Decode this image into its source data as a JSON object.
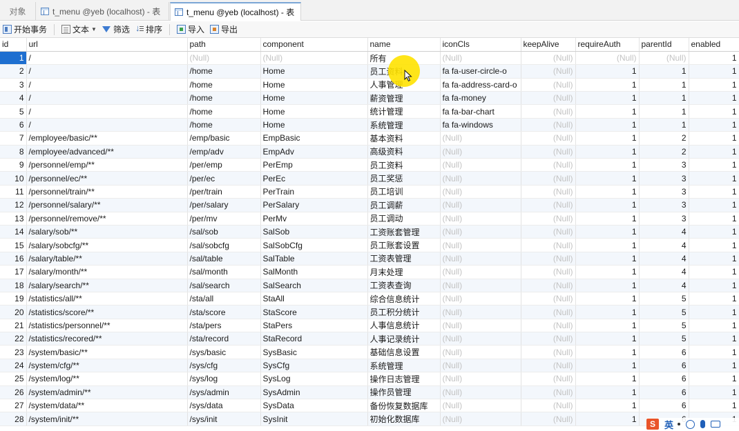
{
  "tabs": [
    {
      "label": "对象"
    },
    {
      "label": "t_menu @yeb (localhost) - 表"
    },
    {
      "label": "t_menu @yeb (localhost) - 表"
    }
  ],
  "toolbar": {
    "begin_transaction": "开始事务",
    "text": "文本",
    "filter": "筛选",
    "sort": "排序",
    "import": "导入",
    "export": "导出"
  },
  "table": {
    "columns": [
      "id",
      "url",
      "path",
      "component",
      "name",
      "iconCls",
      "keepAlive",
      "requireAuth",
      "parentId",
      "enabled"
    ],
    "null_text": "(Null)",
    "rows": [
      [
        "1",
        "/",
        null,
        null,
        "所有",
        null,
        null,
        null,
        null,
        "1"
      ],
      [
        "2",
        "/",
        "/home",
        "Home",
        "员工资料",
        "fa fa-user-circle-o",
        null,
        "1",
        "1",
        "1"
      ],
      [
        "3",
        "/",
        "/home",
        "Home",
        "人事管理",
        "fa fa-address-card-o",
        null,
        "1",
        "1",
        "1"
      ],
      [
        "4",
        "/",
        "/home",
        "Home",
        "薪资管理",
        "fa fa-money",
        null,
        "1",
        "1",
        "1"
      ],
      [
        "5",
        "/",
        "/home",
        "Home",
        "统计管理",
        "fa fa-bar-chart",
        null,
        "1",
        "1",
        "1"
      ],
      [
        "6",
        "/",
        "/home",
        "Home",
        "系统管理",
        "fa fa-windows",
        null,
        "1",
        "1",
        "1"
      ],
      [
        "7",
        "/employee/basic/**",
        "/emp/basic",
        "EmpBasic",
        "基本资料",
        null,
        null,
        "1",
        "2",
        "1"
      ],
      [
        "8",
        "/employee/advanced/**",
        "/emp/adv",
        "EmpAdv",
        "高级资料",
        null,
        null,
        "1",
        "2",
        "1"
      ],
      [
        "9",
        "/personnel/emp/**",
        "/per/emp",
        "PerEmp",
        "员工资料",
        null,
        null,
        "1",
        "3",
        "1"
      ],
      [
        "10",
        "/personnel/ec/**",
        "/per/ec",
        "PerEc",
        "员工奖惩",
        null,
        null,
        "1",
        "3",
        "1"
      ],
      [
        "11",
        "/personnel/train/**",
        "/per/train",
        "PerTrain",
        "员工培训",
        null,
        null,
        "1",
        "3",
        "1"
      ],
      [
        "12",
        "/personnel/salary/**",
        "/per/salary",
        "PerSalary",
        "员工调薪",
        null,
        null,
        "1",
        "3",
        "1"
      ],
      [
        "13",
        "/personnel/remove/**",
        "/per/mv",
        "PerMv",
        "员工调动",
        null,
        null,
        "1",
        "3",
        "1"
      ],
      [
        "14",
        "/salary/sob/**",
        "/sal/sob",
        "SalSob",
        "工资账套管理",
        null,
        null,
        "1",
        "4",
        "1"
      ],
      [
        "15",
        "/salary/sobcfg/**",
        "/sal/sobcfg",
        "SalSobCfg",
        "员工账套设置",
        null,
        null,
        "1",
        "4",
        "1"
      ],
      [
        "16",
        "/salary/table/**",
        "/sal/table",
        "SalTable",
        "工资表管理",
        null,
        null,
        "1",
        "4",
        "1"
      ],
      [
        "17",
        "/salary/month/**",
        "/sal/month",
        "SalMonth",
        "月末处理",
        null,
        null,
        "1",
        "4",
        "1"
      ],
      [
        "18",
        "/salary/search/**",
        "/sal/search",
        "SalSearch",
        "工资表查询",
        null,
        null,
        "1",
        "4",
        "1"
      ],
      [
        "19",
        "/statistics/all/**",
        "/sta/all",
        "StaAll",
        "综合信息统计",
        null,
        null,
        "1",
        "5",
        "1"
      ],
      [
        "20",
        "/statistics/score/**",
        "/sta/score",
        "StaScore",
        "员工积分统计",
        null,
        null,
        "1",
        "5",
        "1"
      ],
      [
        "21",
        "/statistics/personnel/**",
        "/sta/pers",
        "StaPers",
        "人事信息统计",
        null,
        null,
        "1",
        "5",
        "1"
      ],
      [
        "22",
        "/statistics/recored/**",
        "/sta/record",
        "StaRecord",
        "人事记录统计",
        null,
        null,
        "1",
        "5",
        "1"
      ],
      [
        "23",
        "/system/basic/**",
        "/sys/basic",
        "SysBasic",
        "基础信息设置",
        null,
        null,
        "1",
        "6",
        "1"
      ],
      [
        "24",
        "/system/cfg/**",
        "/sys/cfg",
        "SysCfg",
        "系统管理",
        null,
        null,
        "1",
        "6",
        "1"
      ],
      [
        "25",
        "/system/log/**",
        "/sys/log",
        "SysLog",
        "操作日志管理",
        null,
        null,
        "1",
        "6",
        "1"
      ],
      [
        "26",
        "/system/admin/**",
        "/sys/admin",
        "SysAdmin",
        "操作员管理",
        null,
        null,
        "1",
        "6",
        "1"
      ],
      [
        "27",
        "/system/data/**",
        "/sys/data",
        "SysData",
        "备份恢复数据库",
        null,
        null,
        "1",
        "6",
        "1"
      ],
      [
        "28",
        "/system/init/**",
        "/sys/init",
        "SysInit",
        "初始化数据库",
        null,
        null,
        "1",
        "6",
        "1"
      ]
    ]
  },
  "ime": {
    "brand": "S",
    "mode": "英"
  },
  "colors": {
    "selection": "#1e6fd0",
    "null_text": "#c3c3c3",
    "row_alt": "#f3f7fc",
    "highlight": "#ffe200"
  }
}
